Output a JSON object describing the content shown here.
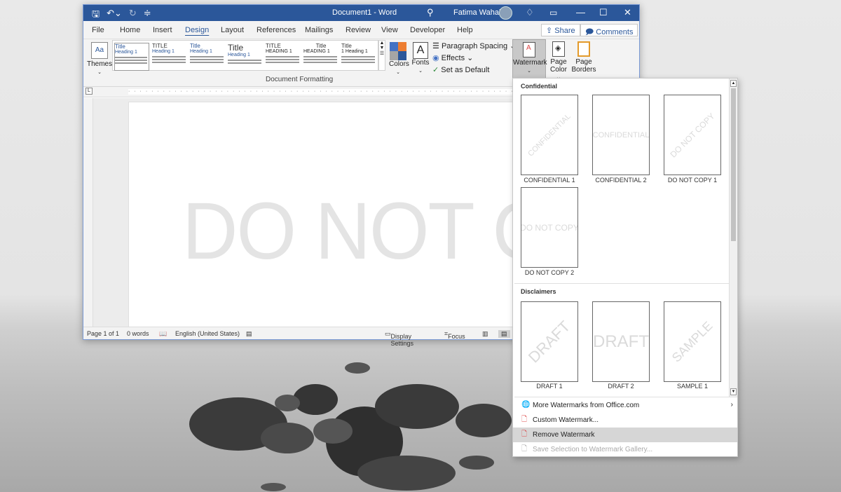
{
  "window": {
    "doc_title": "Document1 - Word",
    "user_name": "Fatima Wahab"
  },
  "tabs": [
    "File",
    "Home",
    "Insert",
    "Design",
    "Layout",
    "References",
    "Mailings",
    "Review",
    "View",
    "Developer",
    "Help"
  ],
  "tab_active": "Design",
  "header_buttons": {
    "share": "Share",
    "comments": "Comments"
  },
  "ribbon": {
    "themes": "Themes",
    "styles": [
      {
        "title": "Title",
        "heading": "Heading 1"
      },
      {
        "title": "TITLE",
        "heading": "Heading 1"
      },
      {
        "title": "Title",
        "heading": "Heading 1"
      },
      {
        "title": "Title",
        "heading": "Heading 1"
      },
      {
        "title": "TITLE",
        "heading": "HEADING 1"
      },
      {
        "title": "Title",
        "heading": "HEADING 1"
      },
      {
        "title": "Title",
        "heading": "1 Heading 1"
      }
    ],
    "group_label": "Document Formatting",
    "colors": "Colors",
    "fonts": "Fonts",
    "fonts_icon_letter": "A",
    "paragraph_spacing": "Paragraph Spacing",
    "effects": "Effects",
    "set_default": "Set as Default",
    "watermark": "Watermark",
    "page_color_1": "Page",
    "page_color_2": "Color",
    "page_borders_1": "Page",
    "page_borders_2": "Borders",
    "accent_colors": [
      "#4472c4",
      "#ed7d31",
      "#a5a5a5",
      "#2b579a"
    ]
  },
  "document": {
    "watermark_text": "DO NOT COPY"
  },
  "status": {
    "page": "Page 1 of 1",
    "words": "0 words",
    "language": "English (United States)",
    "display_settings": "Display Settings",
    "focus": "Focus"
  },
  "dropdown": {
    "section_confidential": "Confidential",
    "section_disclaimers": "Disclaimers",
    "confidential_items": [
      {
        "label": "CONFIDENTIAL 1",
        "text": "CONFIDENTIAL"
      },
      {
        "label": "CONFIDENTIAL 2",
        "text": "CONFIDENTIAL"
      },
      {
        "label": "DO NOT COPY 1",
        "text": "DO NOT COPY"
      },
      {
        "label": "DO NOT COPY 2",
        "text": "DO NOT COPY"
      }
    ],
    "disclaimer_items": [
      {
        "label": "DRAFT 1",
        "text": "DRAFT"
      },
      {
        "label": "DRAFT 2",
        "text": "DRAFT"
      },
      {
        "label": "SAMPLE 1",
        "text": "SAMPLE"
      }
    ],
    "menu": {
      "more": "More Watermarks from Office.com",
      "custom": "Custom Watermark...",
      "remove": "Remove Watermark",
      "save": "Save Selection to Watermark Gallery..."
    }
  }
}
